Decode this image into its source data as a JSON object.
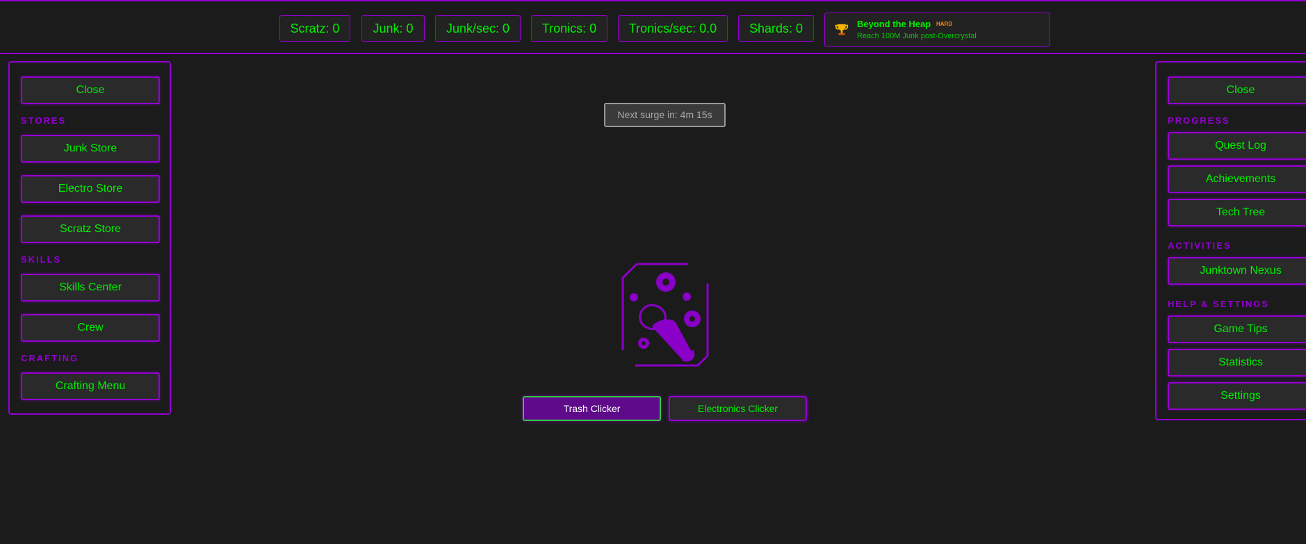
{
  "stats": {
    "scratz": "Scratz: 0",
    "junk": "Junk: 0",
    "junk_sec": "Junk/sec: 0",
    "tronics": "Tronics: 0",
    "tronics_sec": "Tronics/sec: 0.0",
    "shards": "Shards: 0"
  },
  "achievement": {
    "title": "Beyond the Heap",
    "difficulty": "HARD",
    "description": "Reach 100M Junk post-Overcrystal",
    "icon": "trophy-icon"
  },
  "left_panel": {
    "close_label": "Close",
    "stores_heading": "STORES",
    "junk_store": "Junk Store",
    "electro_store": "Electro Store",
    "scratz_store": "Scratz Store",
    "skills_heading": "SKILLS",
    "skills_center": "Skills Center",
    "crew": "Crew",
    "crafting_heading": "CRAFTING",
    "crafting_menu": "Crafting Menu"
  },
  "right_panel": {
    "close_label": "Close",
    "progress_heading": "PROGRESS",
    "quest_log": "Quest Log",
    "achievements": "Achievements",
    "tech_tree": "Tech Tree",
    "activities_heading": "ACTIVITIES",
    "junktown_nexus": "Junktown Nexus",
    "help_heading": "HELP & SETTINGS",
    "game_tips": "Game Tips",
    "statistics": "Statistics",
    "settings": "Settings"
  },
  "main": {
    "surge_text": "Next surge in: 4m 15s",
    "clicker_icon": "trash-can-gears-icon",
    "trash_clicker": "Trash Clicker",
    "electronics_clicker": "Electronics Clicker"
  },
  "colors": {
    "accent": "#9400d3",
    "text": "#00ee00",
    "background": "#1b1b1b",
    "badge": "#ff8c00"
  }
}
